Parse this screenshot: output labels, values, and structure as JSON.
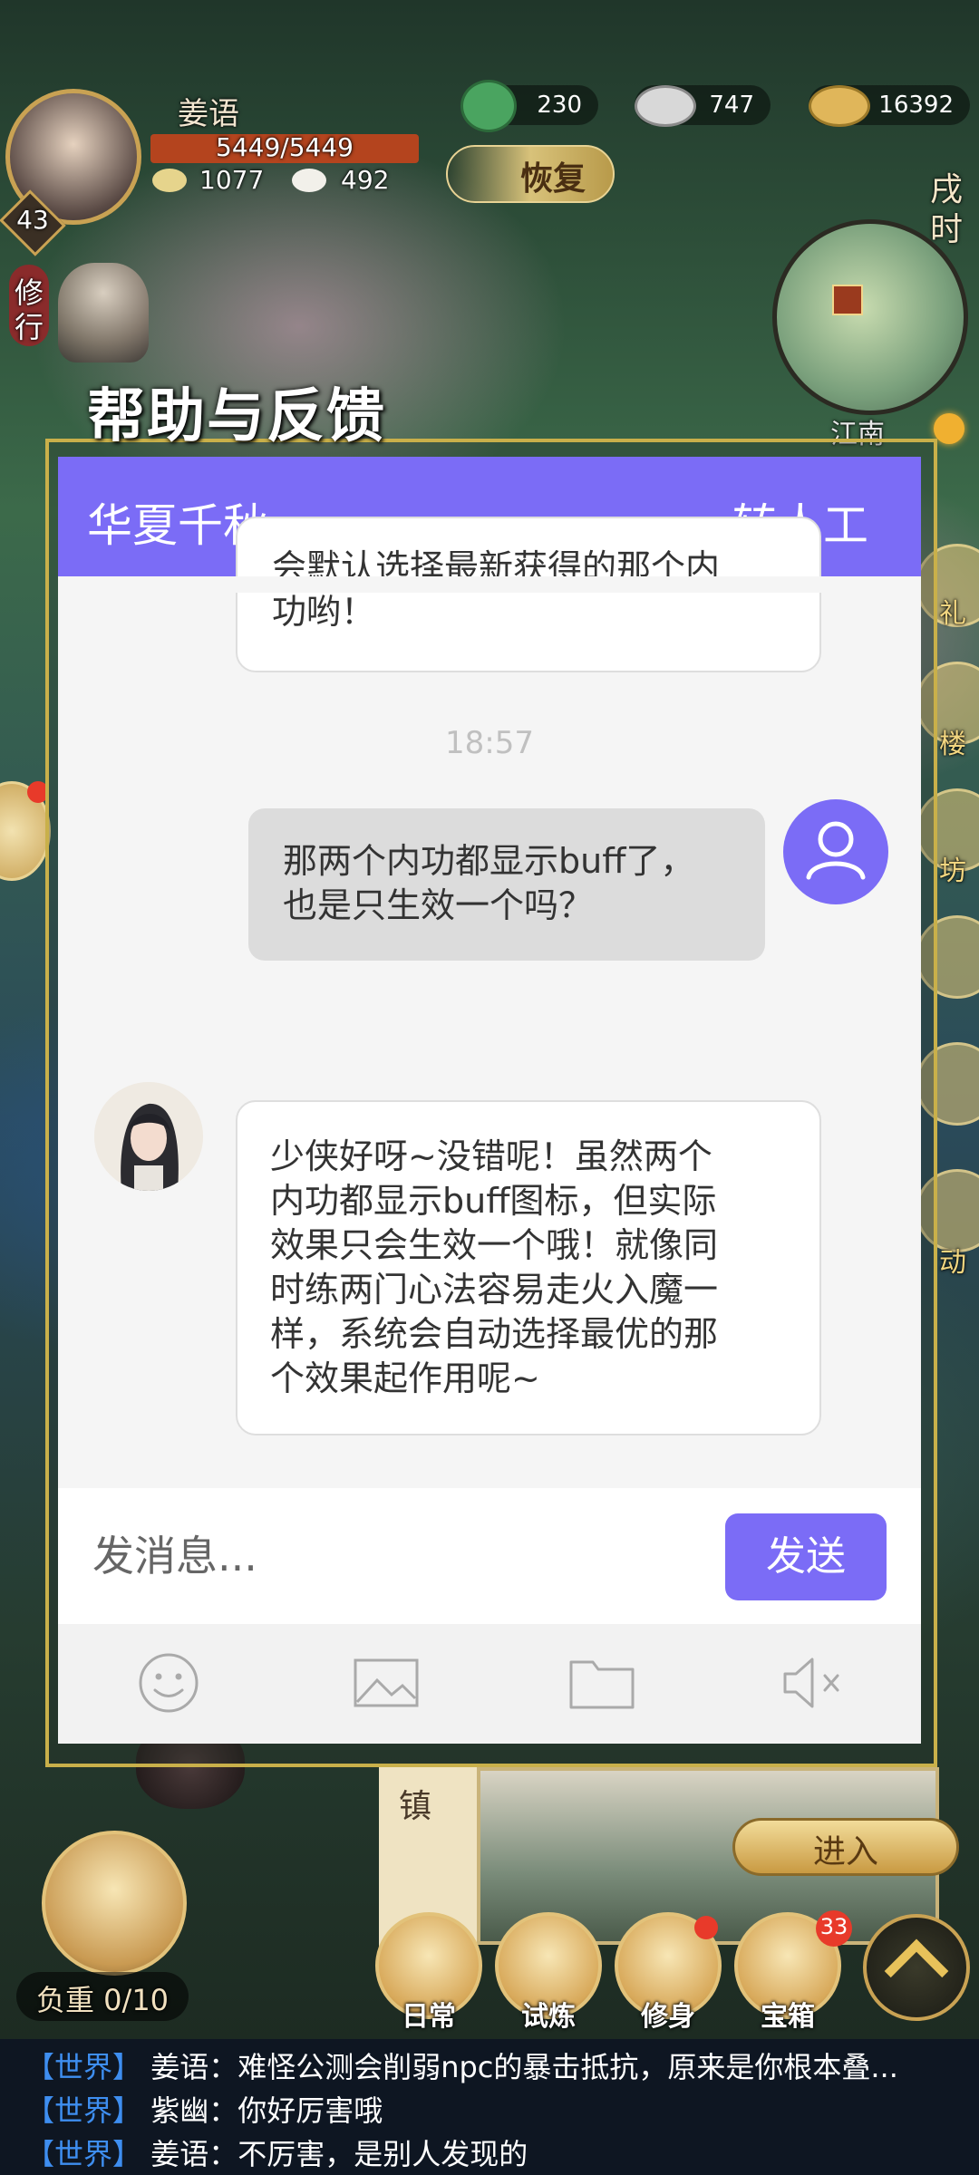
{
  "hud": {
    "player_name": "姜语",
    "level": "43",
    "hp": "5449/5449",
    "stat_a": "1077",
    "stat_b": "492",
    "res_1": "230",
    "res_2": "747",
    "res_3": "16392",
    "restore_label": "恢复",
    "time_label_1": "戌",
    "time_label_2": "时",
    "cultivate_1": "修",
    "cultivate_2": "行",
    "minimap_label": "江南",
    "side_labels": [
      "礼",
      "楼",
      "坊",
      "动"
    ],
    "town_label": "镇",
    "enter_label": "进入",
    "load_label": "负重 0/10",
    "nav": [
      "日常",
      "试炼",
      "修身",
      "宝箱"
    ],
    "chest_badge": "33"
  },
  "modal": {
    "title": "帮助与反馈",
    "app_name": "华夏千秋",
    "human_label": "转人工",
    "messages": {
      "agent_prev_tail_1": "会默认选择最新获得的那个内",
      "agent_prev_tail_2": "功哟！",
      "timestamp": "18:57",
      "user_line_1": "那两个内功都显示buff了，",
      "user_line_2": "也是只生效一个吗？",
      "agent_lines": [
        "少侠好呀~没错呢！虽然两个",
        "内功都显示buff图标，但实际",
        "效果只会生效一个哦！就像同",
        "时练两门心法容易走火入魔一",
        "样，系统会自动选择最优的那",
        "个效果起作用呢~"
      ]
    },
    "input_placeholder": "发消息...",
    "send_label": "发送",
    "tools": [
      "emoji-icon",
      "image-icon",
      "folder-icon",
      "mute-icon"
    ]
  },
  "world_chat": [
    {
      "channel": "【世界】",
      "text": "姜语：难怪公测会削弱npc的暴击抵抗，原来是你根本叠..."
    },
    {
      "channel": "【世界】",
      "text": "紫幽：你好厉害哦"
    },
    {
      "channel": "【世界】",
      "text": "姜语：不厉害，是别人发现的"
    }
  ],
  "colors": {
    "accent": "#7b6cf6",
    "panel_bg": "#f5f5f5",
    "channel": "#3e8ef0"
  }
}
